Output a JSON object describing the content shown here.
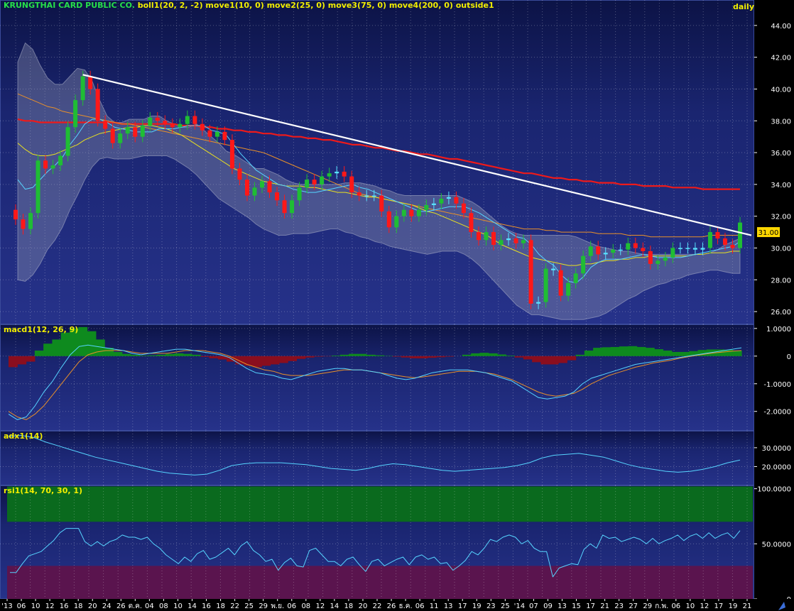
{
  "colors": {
    "background_top": "#26328a",
    "background_bottom": "#0c1346",
    "grid": "#ffffff",
    "up_candle": "#1fbd34",
    "down_candle": "#ff1818",
    "doji": "#58e2ff",
    "bollinger_band": "#9aa0b8",
    "move1": "#56d4ff",
    "move2": "#e8e020",
    "move3": "#e8902a",
    "move4": "#ee1a1a",
    "trendline": "#ffffff",
    "macd_line": "#56d4ff",
    "signal_line": "#e8902a",
    "hist_pos": "#0e8a1e",
    "hist_neg": "#8a0e1e",
    "adx_line": "#56d4ff",
    "rsi_line": "#56d4ff",
    "rsi_overbought_zone": "#0a6a1e",
    "rsi_oversold_zone": "#5a144e",
    "price_tag": "#ffd800"
  },
  "price_panel": {
    "company": "KRUNGTHAI CARD PUBLIC CO.",
    "indicators": "boll1(20, 2, -2) move1(10, 0) move2(25, 0) move3(75, 0) move4(200, 0) outside1",
    "period": "daily",
    "last_price_label": "31.00"
  },
  "macd_panel": {
    "title": "macd1(12, 26, 9)"
  },
  "adx_panel": {
    "title": "adx1(14)"
  },
  "rsi_panel": {
    "title": "rsi1(14, 70, 30, 1)"
  },
  "chart_data": [
    {
      "type": "candlestick",
      "title": "KRUNGTHAI CARD PUBLIC CO.",
      "ylim": [
        25.2,
        45.6
      ],
      "y_ticks": [
        "44.00",
        "42.00",
        "40.00",
        "38.00",
        "36.00",
        "34.00",
        "32.00",
        "30.00",
        "28.00",
        "26.00"
      ],
      "last_price": 31.0,
      "close": [
        31.8,
        31.2,
        32.2,
        35.5,
        35.0,
        35.2,
        35.8,
        37.6,
        39.3,
        40.8,
        40.0,
        38.0,
        37.5,
        36.6,
        37.2,
        37.6,
        37.0,
        37.7,
        38.2,
        38.0,
        37.8,
        37.6,
        37.8,
        38.3,
        37.8,
        37.4,
        37.0,
        37.3,
        36.8,
        35.0,
        34.3,
        33.3,
        33.8,
        34.2,
        33.5,
        33.0,
        32.2,
        33.0,
        33.8,
        34.3,
        34.0,
        34.5,
        34.7,
        34.8,
        34.5,
        33.5,
        33.3,
        33.3,
        33.3,
        32.3,
        31.3,
        32.0,
        32.4,
        32.0,
        32.4,
        32.7,
        32.8,
        33.1,
        33.2,
        32.8,
        32.2,
        31.0,
        30.5,
        31.0,
        30.2,
        30.5,
        30.6,
        30.3,
        30.5,
        26.5,
        26.6,
        28.7,
        28.6,
        27.0,
        27.8,
        28.4,
        29.5,
        30.1,
        29.6,
        29.7,
        29.9,
        29.9,
        30.3,
        30.0,
        29.8,
        29.0,
        29.2,
        29.4,
        30.0,
        30.0,
        30.0,
        29.9,
        30.0,
        31.0,
        30.6,
        30.2,
        30.0,
        31.6
      ],
      "bollinger_upper": [
        41.7,
        42.9,
        42.5,
        41.5,
        40.7,
        40.3,
        40.3,
        40.8,
        41.3,
        41.2,
        40.5,
        39.3,
        38.3,
        37.9,
        37.9,
        38.1,
        38.1,
        38.1,
        38.3,
        38.3,
        38.0,
        37.8,
        37.6,
        37.6,
        37.8,
        37.4,
        37.0,
        36.6,
        36.1,
        35.9,
        35.6,
        35.3,
        35.0,
        35.0,
        34.8,
        34.6,
        34.3,
        34.1,
        34.0,
        34.0,
        34.0,
        34.0,
        34.0,
        34.0,
        34.1,
        34.1,
        34.1,
        34.0,
        33.9,
        33.7,
        33.6,
        33.4,
        33.3,
        33.3,
        33.3,
        33.3,
        33.3,
        33.3,
        33.3,
        33.3,
        33.1,
        32.9,
        32.6,
        32.2,
        31.8,
        31.4,
        31.1,
        30.9,
        30.8,
        30.8,
        30.8,
        30.8,
        30.8,
        30.8,
        30.8,
        30.7,
        30.5,
        30.3,
        30.1,
        30.0,
        29.9,
        29.8,
        29.8,
        29.7,
        29.6,
        29.6,
        29.6,
        29.6,
        29.6,
        29.6,
        29.6,
        29.6,
        29.6,
        29.7,
        29.9,
        30.2,
        30.4,
        30.6
      ],
      "bollinger_lower": [
        28.0,
        27.9,
        28.3,
        29.0,
        29.9,
        30.5,
        31.3,
        32.4,
        33.3,
        34.3,
        35.1,
        35.6,
        35.7,
        35.6,
        35.6,
        35.6,
        35.7,
        35.8,
        35.8,
        35.8,
        35.8,
        35.6,
        35.3,
        35.0,
        34.6,
        34.1,
        33.6,
        33.1,
        32.8,
        32.5,
        32.2,
        31.9,
        31.5,
        31.2,
        31.0,
        30.8,
        30.8,
        30.9,
        30.9,
        30.9,
        31.0,
        31.1,
        31.2,
        31.2,
        31.0,
        30.9,
        30.7,
        30.6,
        30.4,
        30.3,
        30.1,
        30.0,
        29.9,
        29.8,
        29.7,
        29.6,
        29.7,
        29.8,
        29.8,
        29.8,
        29.6,
        29.3,
        28.9,
        28.4,
        27.9,
        27.4,
        26.9,
        26.4,
        26.1,
        25.8,
        25.8,
        25.7,
        25.6,
        25.5,
        25.5,
        25.5,
        25.5,
        25.6,
        25.7,
        25.9,
        26.2,
        26.5,
        26.8,
        27.0,
        27.3,
        27.5,
        27.7,
        27.8,
        28.0,
        28.1,
        28.3,
        28.4,
        28.5,
        28.6,
        28.6,
        28.5,
        28.4,
        28.4
      ],
      "move1": [
        34.3,
        33.7,
        33.8,
        34.3,
        34.8,
        35.2,
        35.7,
        36.5,
        37.1,
        37.8,
        38.1,
        38.1,
        37.9,
        37.6,
        37.5,
        37.4,
        37.3,
        37.3,
        37.3,
        37.5,
        37.5,
        37.5,
        37.6,
        37.7,
        37.7,
        37.7,
        37.4,
        37.3,
        37.1,
        36.5,
        35.9,
        35.4,
        34.9,
        34.6,
        34.3,
        34.0,
        33.9,
        33.7,
        33.6,
        33.5,
        33.5,
        33.6,
        33.7,
        33.8,
        33.9,
        34.0,
        33.8,
        33.7,
        33.5,
        33.3,
        33.1,
        32.9,
        32.7,
        32.5,
        32.3,
        32.3,
        32.4,
        32.5,
        32.6,
        32.6,
        32.6,
        32.4,
        32.2,
        31.9,
        31.6,
        31.3,
        31.0,
        30.7,
        30.6,
        30.2,
        29.6,
        29.2,
        28.9,
        28.3,
        27.9,
        27.8,
        28.2,
        28.8,
        29.1,
        29.3,
        29.3,
        29.3,
        29.4,
        29.5,
        29.6,
        29.5,
        29.4,
        29.4,
        29.4,
        29.4,
        29.5,
        29.6,
        29.7,
        29.8,
        29.9,
        30.0,
        30.1,
        30.4
      ],
      "move2": [
        36.6,
        36.2,
        35.9,
        35.8,
        35.8,
        35.9,
        36.1,
        36.3,
        36.5,
        36.8,
        37.0,
        37.2,
        37.3,
        37.4,
        37.5,
        37.6,
        37.6,
        37.7,
        37.7,
        37.6,
        37.5,
        37.3,
        37.1,
        36.8,
        36.5,
        36.2,
        35.9,
        35.6,
        35.3,
        35.0,
        34.8,
        34.6,
        34.4,
        34.2,
        34.1,
        34.0,
        33.9,
        33.9,
        33.9,
        33.8,
        33.8,
        33.7,
        33.6,
        33.5,
        33.5,
        33.4,
        33.3,
        33.2,
        33.2,
        33.1,
        33.0,
        32.9,
        32.8,
        32.7,
        32.5,
        32.3,
        32.2,
        32.0,
        31.8,
        31.6,
        31.4,
        31.2,
        31.0,
        30.8,
        30.5,
        30.2,
        30.0,
        29.8,
        29.6,
        29.4,
        29.3,
        29.2,
        29.1,
        29.0,
        28.9,
        28.9,
        29.0,
        29.0,
        29.1,
        29.2,
        29.2,
        29.3,
        29.3,
        29.4,
        29.4,
        29.5,
        29.5,
        29.5,
        29.5,
        29.5,
        29.5,
        29.6,
        29.6,
        29.7,
        29.7,
        29.7,
        29.8,
        29.8
      ],
      "move3": [
        39.7,
        39.5,
        39.3,
        39.1,
        38.9,
        38.8,
        38.6,
        38.5,
        38.4,
        38.3,
        38.2,
        38.1,
        38.0,
        37.9,
        37.8,
        37.8,
        37.7,
        37.6,
        37.5,
        37.4,
        37.3,
        37.2,
        37.1,
        37.0,
        36.9,
        36.8,
        36.7,
        36.6,
        36.5,
        36.4,
        36.3,
        36.2,
        36.1,
        36.0,
        35.8,
        35.6,
        35.4,
        35.2,
        35.0,
        34.8,
        34.6,
        34.4,
        34.2,
        34.0,
        33.8,
        33.6,
        33.4,
        33.3,
        33.2,
        33.1,
        33.0,
        32.9,
        32.8,
        32.7,
        32.6,
        32.5,
        32.4,
        32.3,
        32.2,
        32.1,
        32.0,
        31.9,
        31.8,
        31.7,
        31.6,
        31.5,
        31.4,
        31.3,
        31.2,
        31.2,
        31.2,
        31.1,
        31.1,
        31.0,
        31.0,
        31.0,
        31.0,
        31.0,
        30.9,
        30.9,
        30.9,
        30.9,
        30.8,
        30.8,
        30.8,
        30.7,
        30.7,
        30.7,
        30.7,
        30.7,
        30.7,
        30.7,
        30.7,
        30.8,
        30.8,
        30.8,
        30.8,
        30.8
      ],
      "move4": [
        38.1,
        38.0,
        38.0,
        37.9,
        37.9,
        37.9,
        37.9,
        37.9,
        37.9,
        37.9,
        37.9,
        37.9,
        37.9,
        37.9,
        37.8,
        37.8,
        37.8,
        37.8,
        37.8,
        37.8,
        37.8,
        37.8,
        37.7,
        37.7,
        37.7,
        37.6,
        37.6,
        37.5,
        37.5,
        37.4,
        37.4,
        37.3,
        37.3,
        37.2,
        37.2,
        37.1,
        37.1,
        37.0,
        37.0,
        36.9,
        36.9,
        36.8,
        36.8,
        36.7,
        36.6,
        36.5,
        36.5,
        36.4,
        36.3,
        36.3,
        36.2,
        36.1,
        36.1,
        36.0,
        35.9,
        35.9,
        35.8,
        35.7,
        35.6,
        35.6,
        35.5,
        35.4,
        35.3,
        35.2,
        35.1,
        35.0,
        34.9,
        34.8,
        34.7,
        34.7,
        34.6,
        34.5,
        34.4,
        34.4,
        34.3,
        34.3,
        34.2,
        34.2,
        34.1,
        34.1,
        34.1,
        34.0,
        34.0,
        34.0,
        33.9,
        33.9,
        33.9,
        33.9,
        33.8,
        33.8,
        33.8,
        33.8,
        33.7,
        33.7,
        33.7,
        33.7,
        33.7,
        33.7
      ],
      "trendline": {
        "from": [
          9,
          40.9
        ],
        "to": [
          97,
          30.8
        ]
      }
    },
    {
      "type": "line",
      "title": "macd1(12, 26, 9)",
      "ylim": [
        -2.7,
        1.15
      ],
      "y_ticks": [
        "1.0000",
        "0",
        "-1.0000",
        "-2.0000"
      ],
      "series": [
        {
          "values": [
            -2.1,
            -2.3,
            -2.2,
            -1.8,
            -1.3,
            -0.9,
            -0.4,
            0.05,
            0.35,
            0.4,
            0.35,
            0.3,
            0.25,
            0.2,
            0.1,
            0.05,
            0.1,
            0.15,
            0.2,
            0.25,
            0.25,
            0.2,
            0.15,
            0.1,
            0.05,
            -0.05,
            -0.25,
            -0.45,
            -0.6,
            -0.65,
            -0.7,
            -0.8,
            -0.85,
            -0.75,
            -0.65,
            -0.55,
            -0.5,
            -0.45,
            -0.45,
            -0.5,
            -0.5,
            -0.55,
            -0.6,
            -0.7,
            -0.8,
            -0.85,
            -0.8,
            -0.7,
            -0.6,
            -0.55,
            -0.5,
            -0.5,
            -0.5,
            -0.55,
            -0.6,
            -0.7,
            -0.8,
            -0.9,
            -1.1,
            -1.3,
            -1.5,
            -1.55,
            -1.5,
            -1.45,
            -1.3,
            -1.0,
            -0.8,
            -0.7,
            -0.6,
            -0.5,
            -0.4,
            -0.3,
            -0.25,
            -0.2,
            -0.15,
            -0.1,
            -0.05,
            0.0,
            0.05,
            0.1,
            0.15,
            0.2,
            0.25,
            0.3
          ]
        },
        {
          "values": [
            -2.0,
            -2.2,
            -2.3,
            -2.1,
            -1.8,
            -1.4,
            -1.0,
            -0.6,
            -0.2,
            0.05,
            0.15,
            0.2,
            0.2,
            0.2,
            0.15,
            0.1,
            0.1,
            0.1,
            0.1,
            0.15,
            0.2,
            0.2,
            0.2,
            0.15,
            0.1,
            0.0,
            -0.15,
            -0.3,
            -0.4,
            -0.5,
            -0.55,
            -0.65,
            -0.7,
            -0.7,
            -0.7,
            -0.65,
            -0.6,
            -0.55,
            -0.5,
            -0.5,
            -0.5,
            -0.55,
            -0.6,
            -0.65,
            -0.7,
            -0.75,
            -0.78,
            -0.75,
            -0.7,
            -0.65,
            -0.6,
            -0.55,
            -0.55,
            -0.55,
            -0.6,
            -0.65,
            -0.75,
            -0.85,
            -1.0,
            -1.15,
            -1.3,
            -1.4,
            -1.45,
            -1.4,
            -1.35,
            -1.2,
            -1.0,
            -0.85,
            -0.7,
            -0.6,
            -0.5,
            -0.4,
            -0.33,
            -0.25,
            -0.2,
            -0.15,
            -0.08,
            -0.02,
            0.03,
            0.08,
            0.12,
            0.15,
            0.18,
            0.2
          ]
        }
      ],
      "histogram": [
        -0.4,
        -0.3,
        -0.2,
        0.2,
        0.45,
        0.6,
        0.85,
        1.0,
        1.05,
        0.9,
        0.6,
        0.3,
        0.15,
        0.08,
        0.05,
        0.02,
        0.03,
        0.05,
        0.08,
        0.1,
        0.08,
        0.05,
        -0.03,
        -0.08,
        -0.12,
        -0.2,
        -0.3,
        -0.35,
        -0.4,
        -0.35,
        -0.3,
        -0.25,
        -0.18,
        -0.1,
        -0.05,
        -0.02,
        -0.01,
        0.02,
        0.05,
        0.08,
        0.08,
        0.05,
        0.03,
        0.01,
        -0.02,
        -0.05,
        -0.08,
        -0.08,
        -0.06,
        -0.04,
        -0.02,
        0.0,
        0.05,
        0.1,
        0.12,
        0.1,
        0.06,
        0.02,
        -0.05,
        -0.12,
        -0.22,
        -0.3,
        -0.3,
        -0.25,
        -0.15,
        0.05,
        0.2,
        0.3,
        0.32,
        0.33,
        0.35,
        0.36,
        0.33,
        0.3,
        0.25,
        0.2,
        0.15,
        0.15,
        0.18,
        0.22,
        0.24,
        0.24,
        0.23,
        0.2
      ]
    },
    {
      "type": "line",
      "title": "adx1(14)",
      "ylim": [
        10,
        39
      ],
      "y_ticks": [
        "30.0000",
        "20.0000"
      ],
      "values": [
        36,
        36.5,
        35.5,
        33,
        31,
        29,
        27,
        25,
        23.5,
        22,
        20.5,
        19,
        17.5,
        16.5,
        16,
        15.5,
        16,
        18,
        20.5,
        21.5,
        22,
        22,
        22,
        21.5,
        21,
        20,
        19,
        18.5,
        18,
        19,
        20.5,
        21.5,
        21,
        20,
        19,
        18,
        17.5,
        18,
        18.5,
        19,
        19.5,
        20.5,
        22,
        24.5,
        26,
        26.5,
        27,
        26,
        25,
        23,
        21,
        19.5,
        18.5,
        17.5,
        17,
        17.5,
        18.5,
        20,
        22,
        23.5
      ]
    },
    {
      "type": "line",
      "title": "rsi1(14, 70, 30, 1)",
      "ylim": [
        0,
        103
      ],
      "y_ticks": [
        "100.0000",
        "50.0000",
        "0"
      ],
      "overbought": 70,
      "oversold": 30,
      "values": [
        24,
        24,
        32,
        39,
        41,
        43,
        48,
        53,
        60,
        64,
        64,
        64,
        52,
        48,
        52,
        48,
        52,
        54,
        58,
        56,
        56,
        54,
        56,
        50,
        46,
        40,
        36,
        32,
        38,
        34,
        41,
        44,
        36,
        38,
        42,
        46,
        40,
        48,
        52,
        44,
        40,
        34,
        36,
        26,
        33,
        37,
        30,
        29,
        44,
        46,
        40,
        34,
        34,
        30,
        36,
        38,
        31,
        25,
        34,
        36,
        30,
        33,
        36,
        38,
        31,
        38,
        40,
        36,
        38,
        32,
        33,
        26,
        30,
        35,
        43,
        40,
        46,
        54,
        52,
        56,
        58,
        56,
        50,
        53,
        46,
        43,
        43,
        20,
        28,
        30,
        32,
        31,
        45,
        50,
        46,
        58,
        55,
        56,
        52,
        54,
        56,
        54,
        50,
        55,
        50,
        53,
        55,
        58,
        53,
        57,
        59,
        55,
        60,
        55,
        58,
        60,
        55,
        62
      ]
    }
  ],
  "x_axis_labels": [
    "'13",
    "06",
    "10",
    "12",
    "16",
    "18",
    "20",
    "24",
    "26",
    "ต.ค.",
    "04",
    "08",
    "10",
    "14",
    "16",
    "18",
    "22",
    "25",
    "29",
    "พ.ย.",
    "06",
    "08",
    "12",
    "14",
    "18",
    "20",
    "22",
    "26",
    "ธ.ค.",
    "06",
    "11",
    "13",
    "17",
    "19",
    "23",
    "25",
    "'14",
    "07",
    "09",
    "13",
    "15",
    "17",
    "21",
    "23",
    "27",
    "29",
    "ก.พ.",
    "06",
    "10",
    "12",
    "17",
    "19",
    "21"
  ]
}
